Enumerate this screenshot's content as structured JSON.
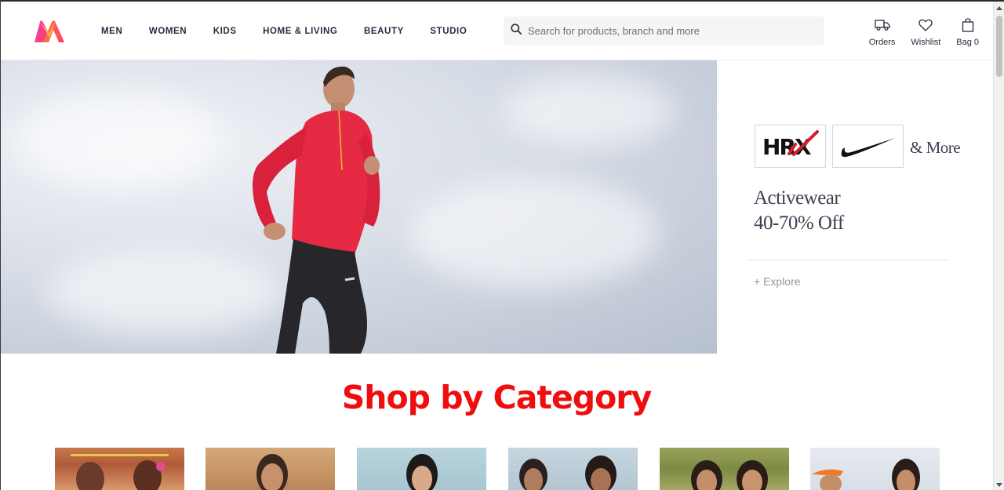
{
  "brand": {
    "logo_icon": "myntra-logo"
  },
  "nav": [
    {
      "label": "MEN"
    },
    {
      "label": "WOMEN"
    },
    {
      "label": "KIDS"
    },
    {
      "label": "HOME & LIVING"
    },
    {
      "label": "BEAUTY"
    },
    {
      "label": "STUDIO"
    }
  ],
  "search": {
    "placeholder": "Search for products, branch and more",
    "value": ""
  },
  "actions": [
    {
      "label": "Orders",
      "icon": "truck-icon"
    },
    {
      "label": "Wishlist",
      "icon": "heart-icon"
    },
    {
      "label": "Bag 0",
      "icon": "bag-icon"
    }
  ],
  "hero": {
    "image": "man running in red jacket against cloudy sky",
    "brand_logos": [
      "HRX",
      "Nike"
    ],
    "hrx_text": "HRX",
    "more_text": "& More",
    "offer_line1": "Activewear",
    "offer_line2": "40-70% Off",
    "explore_label": "+ Explore"
  },
  "category": {
    "title": "Shop by Category",
    "cards": [
      {
        "name": "ethnic-wear-women"
      },
      {
        "name": "mens-ethnic"
      },
      {
        "name": "womens-western"
      },
      {
        "name": "mens-casual"
      },
      {
        "name": "festive-women"
      },
      {
        "name": "sportswear"
      }
    ]
  },
  "colors": {
    "accent_red": "#ef0e0e",
    "text_dark": "#282c3f",
    "search_bg": "#f5f5f6",
    "offer_text": "#3e4152"
  }
}
